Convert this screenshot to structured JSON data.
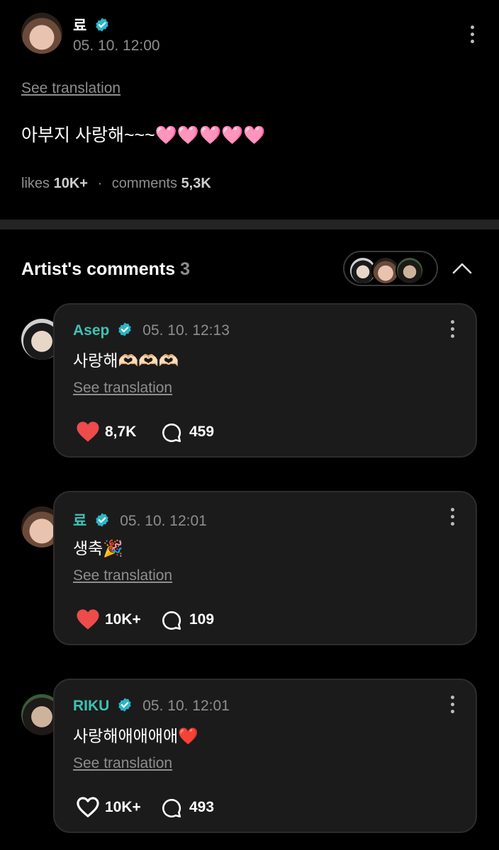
{
  "post": {
    "author": "료",
    "timestamp": "05. 10. 12:00",
    "see_translation": "See translation",
    "text": "아부지 사랑해~~~🩷🩷🩷🩷🩷",
    "likes_label": "likes",
    "likes_count": "10K+",
    "separator": "·",
    "comments_label": "comments",
    "comments_count": "5,3K"
  },
  "artist_comments": {
    "title": "Artist's comments",
    "count": "3",
    "items": [
      {
        "author": "Asep",
        "timestamp": "05. 10. 12:13",
        "text": "사랑해🫶🏻🫶🏻🫶🏻",
        "see_translation": "See translation",
        "likes": "8,7K",
        "liked": true,
        "replies": "459"
      },
      {
        "author": "료",
        "timestamp": "05. 10. 12:01",
        "text": "생축🎉",
        "see_translation": "See translation",
        "likes": "10K+",
        "liked": true,
        "replies": "109"
      },
      {
        "author": "RIKU",
        "timestamp": "05. 10. 12:01",
        "text": "사랑해애애애애❤️",
        "see_translation": "See translation",
        "likes": "10K+",
        "liked": false,
        "replies": "493"
      }
    ]
  },
  "colors": {
    "accent_teal": "#3ec2b3",
    "verified_badge": "#2bb6c7",
    "heart_red": "#ee4b4b",
    "card_bg": "#1b1b1b"
  },
  "icons": [
    "verified-badge-icon",
    "more-options-icon",
    "heart-icon",
    "comment-bubble-icon",
    "chevron-up-icon"
  ]
}
